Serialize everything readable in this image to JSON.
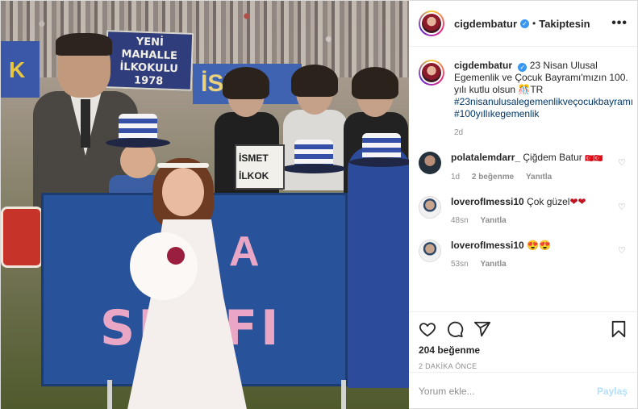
{
  "header": {
    "username": "cigdembatur",
    "verified_icon": "verified-badge-icon",
    "separator": "•",
    "follow_state": "Takiptesin",
    "more_icon": "more-options-icon",
    "more_glyph": "•••"
  },
  "photo": {
    "sign_yeni": [
      "YENİ MAHALLE",
      "İLKOKULU",
      "1978"
    ],
    "sign_left": "K",
    "sign_ism": "İSM",
    "ismet_sign": [
      "İSMET",
      "İLKOK"
    ],
    "banner_top": "A",
    "banner_bottom": "SINIFI"
  },
  "caption": {
    "username": "cigdembatur",
    "text": "23 Nisan Ulusal Egemenlik ve Çocuk Bayramı'mızın 100. yılı kutlu olsun ",
    "emoji": "🎊TR",
    "hashtags": "#23nisanulusalegemenlikveçocukbayramı #100yıllıkegemenlik",
    "time": "2d"
  },
  "comments": [
    {
      "username": "polatalemdarr_",
      "text": "Çiğdem Batur",
      "flag": "🇹🇷🇹🇷",
      "time": "1d",
      "likes": "2 beğenme",
      "reply": "Yanıtla"
    },
    {
      "username": "loverofImessi10",
      "text": "Çok güzel",
      "suffix": "❤❤",
      "time": "48sn",
      "reply": "Yanıtla"
    },
    {
      "username": "loverofImessi10",
      "text": "",
      "suffix": "😍😍",
      "time": "53sn",
      "reply": "Yanıtla"
    }
  ],
  "actions": {
    "like_icon": "heart-icon",
    "comment_icon": "comment-icon",
    "share_icon": "share-icon",
    "save_icon": "bookmark-icon",
    "likes": "204 beğenme",
    "posted": "2 DAKİKA ÖNCE"
  },
  "add_comment": {
    "placeholder": "Yorum ekle...",
    "button": "Paylaş"
  },
  "colors": {
    "link": "#00376b",
    "verified": "#3897f0",
    "share_disabled": "#b2dffc",
    "muted": "#8e8e8e"
  }
}
